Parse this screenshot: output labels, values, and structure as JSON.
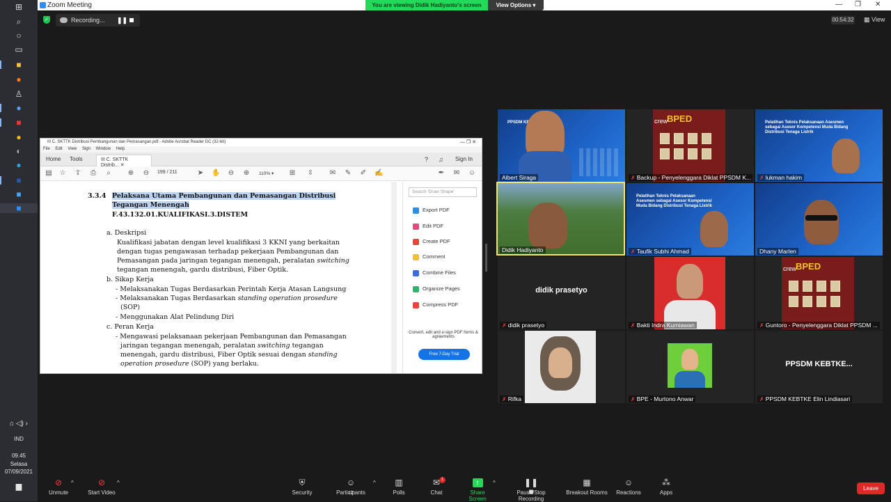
{
  "window": {
    "title": "Zoom Meeting",
    "banner": "You are viewing Didik Hadiyanto's screen",
    "view_options": "View Options"
  },
  "recording": {
    "label": "Recording...",
    "timer": "00:54:32",
    "view": "View"
  },
  "taskbar": {
    "lang": "IND",
    "time": "09.45",
    "day": "Selasa",
    "date": "07/09/2021"
  },
  "acrobat": {
    "title": "III C. SKTTK Distribusi Pembangunan dan Pemasangan.pdf - Adobe Acrobat Reader DC (32-bit)",
    "menu": [
      "File",
      "Edit",
      "View",
      "Sign",
      "Window",
      "Help"
    ],
    "tabs": {
      "home": "Home",
      "tools": "Tools",
      "doc": "III C. SKTTK Distrib...",
      "sign_in": "Sign In"
    },
    "page_num": "199",
    "page_total": "/ 211",
    "zoom": "110%",
    "search_placeholder": "Search 'Draw Shape'",
    "panel": [
      "Export PDF",
      "Edit PDF",
      "Create PDF",
      "Comment",
      "Combine Files",
      "Organize Pages",
      "Compress PDF"
    ],
    "promo": "Convert, edit and e-sign PDF forms & agreements",
    "trial": "Free 7-Day Trial",
    "doc": {
      "num": "3.3.4",
      "h1": "Pelaksana Utama Pembangunan dan Pemasangan Distribusi",
      "h2": "Tegangan Menengah",
      "code": "F.43.132.01.KUALIFIKASI.3.DISTEM",
      "a": "a.  Deskripsi",
      "a1": "Kualifikasi jabatan dengan level kualifikasi 3 KKNI yang berkaitan",
      "a2": "dengan tugas pengawasan terhadap pekerjaan Pembangunan dan",
      "a3": "Pemasangan pada jaringan tegangan menengah, peralatan",
      "a3i": "switching",
      "a4": "tegangan menengah, gardu distribusi, Fiber Optik.",
      "b": "b.  Sikap Kerja",
      "b1": "- Melaksanakan Tugas Berdasarkan Perintah Kerja Atasan Langsung",
      "b2": "- Melaksanakan Tugas Berdasarkan",
      "b2i": "standing operation prosedure",
      "b3": "(SOP)",
      "b4": "- Menggunakan Alat Pelindung Diri",
      "c": "c.  Peran Kerja",
      "c1": "- Mengawasi pelaksanaan pekerjaan Pembangunan dan Pemasangan",
      "c2": "jaringan tegangan menengah, peralatan",
      "c2i": "switching",
      "c2b": "tegangan",
      "c3": "menengah, gardu distribusi, Fiber Optik sesuai dengan",
      "c3i": "standing",
      "c4i": "operation prosedure",
      "c4": "(SOP) yang berlaku."
    }
  },
  "participants": [
    {
      "name": "Albert Siraga"
    },
    {
      "name": "Backup - Penyelenggara Diklat PPSDM K..."
    },
    {
      "name": "lukman hakim"
    },
    {
      "name": "Didik Hadiyanto"
    },
    {
      "name": "Taufik Subhi Ahmad"
    },
    {
      "name": "Dhany Marlen"
    },
    {
      "name": "didik prasetyo",
      "display": "didik prasetyo"
    },
    {
      "name": "Bakti Indra Kurniawan"
    },
    {
      "name": "Guntoro - Penyelenggara Diklat PPSDM ..."
    },
    {
      "name": "Rifka"
    },
    {
      "name": "BPE - Murtono Anwar"
    },
    {
      "name": "PPSDM KEBTKE Elin Lindiasari",
      "display": "PPSDM KEBTKE..."
    }
  ],
  "slide": {
    "brand": "PPSDM KEBTKE",
    "text": "Pelatihan Teknis Pelaksanaan Asesmen sebagai Asesor Kompetensi Muda Bidang Distribusi Tenaga Listrik",
    "bped": "BPED",
    "crew": "crew"
  },
  "toolbar": {
    "unmute": "Unmute",
    "start_video": "Start Video",
    "security": "Security",
    "participants": "Participants",
    "participants_count": "12",
    "polls": "Polls",
    "chat": "Chat",
    "chat_badge": "1",
    "share": "Share Screen",
    "record": "Pause/Stop Recording",
    "breakout": "Breakout Rooms",
    "reactions": "Reactions",
    "apps": "Apps",
    "leave": "Leave"
  },
  "colors": {
    "share_green": "#23d959",
    "leave_red": "#e02828",
    "active_speaker": "#f6e46b",
    "acrobat_blue": "#1473e6"
  }
}
